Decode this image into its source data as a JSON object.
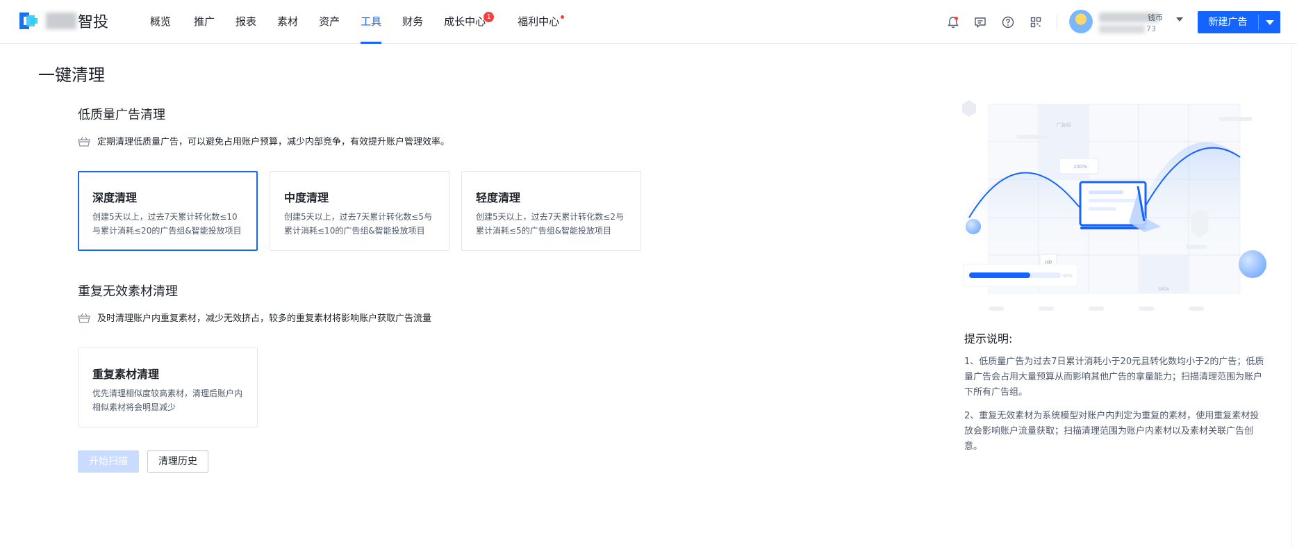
{
  "brand": {
    "name": "智投"
  },
  "nav": [
    {
      "label": "概览",
      "active": false
    },
    {
      "label": "推广",
      "active": false
    },
    {
      "label": "报表",
      "active": false
    },
    {
      "label": "素材",
      "active": false
    },
    {
      "label": "资产",
      "active": false
    },
    {
      "label": "工具",
      "active": true
    },
    {
      "label": "财务",
      "active": false
    },
    {
      "label": "成长中心",
      "badge": "1"
    },
    {
      "label": "福利中心",
      "dot": true
    }
  ],
  "header_icons": [
    "bell-icon",
    "message-icon",
    "help-icon",
    "apps-grid-icon"
  ],
  "account": {
    "line1_suffix": "钱币",
    "line2_suffix": "73"
  },
  "new_ad": {
    "label": "新建广告"
  },
  "page": {
    "title": "一键清理"
  },
  "low_quality": {
    "title": "低质量广告清理",
    "desc": "定期清理低质量广告，可以避免占用账户预算，减少内部竞争，有效提升账户管理效率。",
    "cards": [
      {
        "title": "深度清理",
        "desc": "创建5天以上，过去7天累计转化数≤10与累计消耗≤20的广告组&智能投放项目",
        "selected": true
      },
      {
        "title": "中度清理",
        "desc": "创建5天以上，过去7天累计转化数≤5与累计消耗≤10的广告组&智能投放项目",
        "selected": false
      },
      {
        "title": "轻度清理",
        "desc": "创建5天以上，过去7天累计转化数≤2与累计消耗≤5的广告组&智能投放项目",
        "selected": false
      }
    ]
  },
  "duplicate": {
    "title": "重复无效素材清理",
    "desc": "及时清理账户内重复素材，减少无效挤占，较多的重复素材将影响账户获取广告流量",
    "cards": [
      {
        "title": "重复素材清理",
        "desc": "优先清理相似度较高素材，清理后账户内相似素材将会明显减少",
        "selected": false
      }
    ]
  },
  "actions": {
    "scan": "开始扫描",
    "history": "清理历史"
  },
  "illustration": {
    "label_top": "广告组",
    "label_up": "up",
    "label_pct": "100%",
    "label_bar": "90%",
    "label_data": "DATA"
  },
  "tips": {
    "title": "提示说明:",
    "items": [
      "1、低质量广告为过去7日累计消耗小于20元且转化数均小于2的广告；低质量广告会占用大量预算从而影响其他广告的拿量能力；扫描清理范围为账户下所有广告组。",
      "2、重复无效素材为系统模型对账户内判定为重复的素材，使用重复素材投放会影响账户流量获取；扫描清理范围为账户内素材以及素材关联广告创意。"
    ]
  },
  "colors": {
    "primary": "#1664ff",
    "disabled": "#c9dcff",
    "badge": "#f53f3f"
  }
}
